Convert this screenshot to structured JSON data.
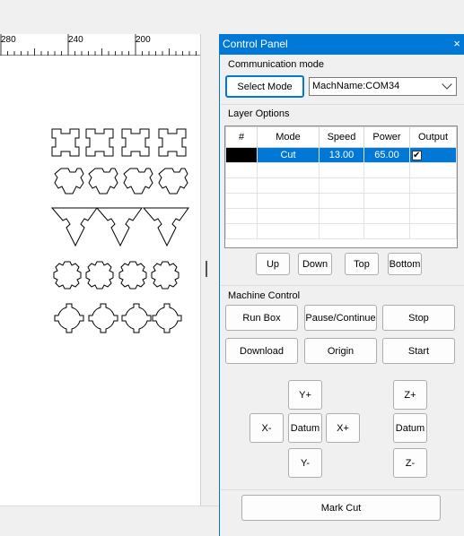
{
  "ruler": {
    "labels": [
      "280",
      "240",
      "200"
    ]
  },
  "panel": {
    "title": "Control Panel",
    "close_glyph": "×"
  },
  "communication": {
    "title": "Communication mode",
    "select_mode_label": "Select Mode",
    "machine_value": "MachName:COM34"
  },
  "layer_options": {
    "title": "Layer Options",
    "columns": [
      "#",
      "Mode",
      "Speed",
      "Power",
      "Output"
    ],
    "rows": [
      {
        "color": "#000000",
        "mode": "Cut",
        "speed": "13.00",
        "power": "65.00",
        "output_checked": true
      }
    ],
    "buttons": {
      "up": "Up",
      "down": "Down",
      "top": "Top",
      "bottom": "Bottom"
    }
  },
  "machine_control": {
    "title": "Machine Control",
    "run_box": "Run Box",
    "pause_continue": "Pause/Continue",
    "stop": "Stop",
    "download": "Download",
    "origin": "Origin",
    "start": "Start",
    "y_plus": "Y+",
    "y_minus": "Y-",
    "x_minus": "X-",
    "x_plus": "X+",
    "datum": "Datum",
    "z_plus": "Z+",
    "z_datum": "Datum",
    "z_minus": "Z-"
  },
  "mark_cut": "Mark Cut",
  "colors": {
    "accent": "#0078d7",
    "panel_bg": "#f0f0f0"
  }
}
